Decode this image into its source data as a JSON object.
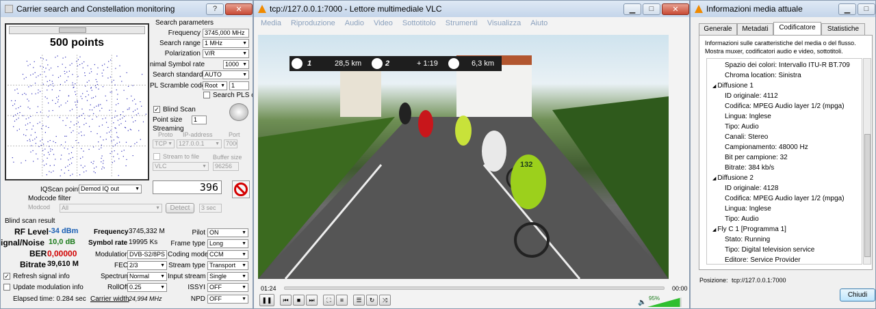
{
  "carrier": {
    "title": "Carrier search and Constellation monitoring",
    "title_help": "?",
    "title_close": "✕",
    "points_label": "500 points",
    "search_params_title": "Search parameters",
    "frequency_label": "Frequency",
    "frequency_value": "3745,000 MHz",
    "search_range_label": "Search range",
    "search_range_value": "1 MHz",
    "polarization_label": "Polarization",
    "polarization_value": "V/R",
    "symbol_rate_label": "nimal Symbol rate",
    "symbol_rate_value": "1000",
    "search_standard_label": "Search standard",
    "search_standard_value": "AUTO",
    "pl_scramble_label": "PL Scramble code",
    "pl_scramble_value": "Root",
    "pl_scramble_num": "1",
    "search_pls_label": "Search PLS cc",
    "blind_scan_label": "Blind Scan",
    "point_size_label": "Point size",
    "point_size_value": "1",
    "streaming_label": "Streaming",
    "proto_label": "Proto",
    "ip_label": "IP-address",
    "port_label": "Port",
    "proto_value": "TCP",
    "ip_value": "127.0.0.1",
    "port_value": "7000",
    "stream_to_file_label": "Stream to file",
    "buffer_size_label": "Buffer size",
    "stream_target_value": "VLC",
    "buffer_value": "96256",
    "iqscan_label": "IQScan point",
    "iqscan_value": "Demod IQ out",
    "counter": "396",
    "modcode_filter_label": "Modcode filter",
    "modcode_label": "Modcod",
    "modcode_value": "All",
    "detect_label": "Detect",
    "detect_time": "3 sec",
    "result_title": "Blind scan result",
    "rf_label": "RF Level",
    "rf_value": "-34 dBm",
    "sn_label": "ignal/Noise",
    "sn_value": "10,0 dB",
    "ber_label": "BER",
    "ber_value": "0,00000",
    "bitrate_label": "Bitrate",
    "bitrate_value": "39,610 M",
    "res_freq_label": "Frequency",
    "res_freq_value": "3745,332 M",
    "res_sr_label": "Symbol rate",
    "res_sr_value": "19995 Ks",
    "modulation_label": "Modulation",
    "modulation_value": "DVB-S2/8PS",
    "fec_label": "FEC",
    "fec_value": "2/3",
    "spectrum_label": "Spectrum",
    "spectrum_value": "Normal",
    "rolloff_label": "RollOff",
    "rolloff_value": "0.25",
    "carrier_width_label": "Carrier width",
    "carrier_width_value": "24,994 MHz",
    "pilot_label": "Pilot",
    "pilot_value": "ON",
    "frame_type_label": "Frame type",
    "frame_type_value": "Long",
    "coding_mode_label": "Coding mode",
    "coding_mode_value": "CCM",
    "stream_type_label": "Stream type",
    "stream_type_value": "Transport",
    "input_stream_label": "Input stream",
    "input_stream_value": "Single",
    "issyi_label": "ISSYI",
    "issyi_value": "OFF",
    "npd_label": "NPD",
    "npd_value": "OFF",
    "refresh_label": "Refresh signal info",
    "update_mod_label": "Update modulation info",
    "elapsed_label": "Elapsed time: 0.284 sec"
  },
  "vlc": {
    "title": "tcp://127.0.0.1:7000 - Lettore multimediale VLC",
    "menu": [
      "Media",
      "Riproduzione",
      "Audio",
      "Video",
      "Sottotitolo",
      "Strumenti",
      "Visualizza",
      "Aiuto"
    ],
    "osd_rank1": "1",
    "osd_dist1": "28,5 km",
    "osd_rank2": "2",
    "osd_gap": "+ 1:19",
    "osd_dist2": "6,3 km",
    "bib_number": "132",
    "time_elapsed": "01:24",
    "time_total": "00:00",
    "volume": "95%",
    "volume_level": 0.95,
    "progress": 0.0
  },
  "info": {
    "title": "Informazioni media attuale",
    "tabs": [
      "Generale",
      "Metadati",
      "Codificatore",
      "Statistiche"
    ],
    "description": "Informazioni sulle caratteristiche del media o del flusso. Mostra muxer, codificatori audio e video, sottotitoli.",
    "tree": [
      {
        "level": 2,
        "text": "Spazio dei colori: Intervallo ITU-R BT.709"
      },
      {
        "level": 2,
        "text": "Chroma location: Sinistra"
      },
      {
        "level": 1,
        "text": "Diffusione 1"
      },
      {
        "level": 2,
        "text": "ID originale: 4112"
      },
      {
        "level": 2,
        "text": "Codifica: MPEG Audio layer 1/2 (mpga)"
      },
      {
        "level": 2,
        "text": "Lingua: Inglese"
      },
      {
        "level": 2,
        "text": "Tipo: Audio"
      },
      {
        "level": 2,
        "text": "Canali: Stereo"
      },
      {
        "level": 2,
        "text": "Campionamento: 48000 Hz"
      },
      {
        "level": 2,
        "text": "Bit per campione: 32"
      },
      {
        "level": 2,
        "text": "Bitrate: 384 kb/s"
      },
      {
        "level": 1,
        "text": "Diffusione 2"
      },
      {
        "level": 2,
        "text": "ID originale: 4128"
      },
      {
        "level": 2,
        "text": "Codifica: MPEG Audio layer 1/2 (mpga)"
      },
      {
        "level": 2,
        "text": "Lingua: Inglese"
      },
      {
        "level": 2,
        "text": "Tipo: Audio"
      },
      {
        "level": 1,
        "text": "Fly C 1 [Programma 1]"
      },
      {
        "level": 2,
        "text": "Stato: Running"
      },
      {
        "level": 2,
        "text": "Tipo: Digital television service"
      },
      {
        "level": 2,
        "text": "Editore: Service Provider"
      }
    ],
    "position_label": "Posizione:",
    "position_value": "tcp://127.0.0.1:7000",
    "close_label": "Chiudi"
  },
  "colors": {
    "accent": "#1a5fb4",
    "ber_red": "#d10000",
    "osd_dark": "#1e1e1e"
  }
}
